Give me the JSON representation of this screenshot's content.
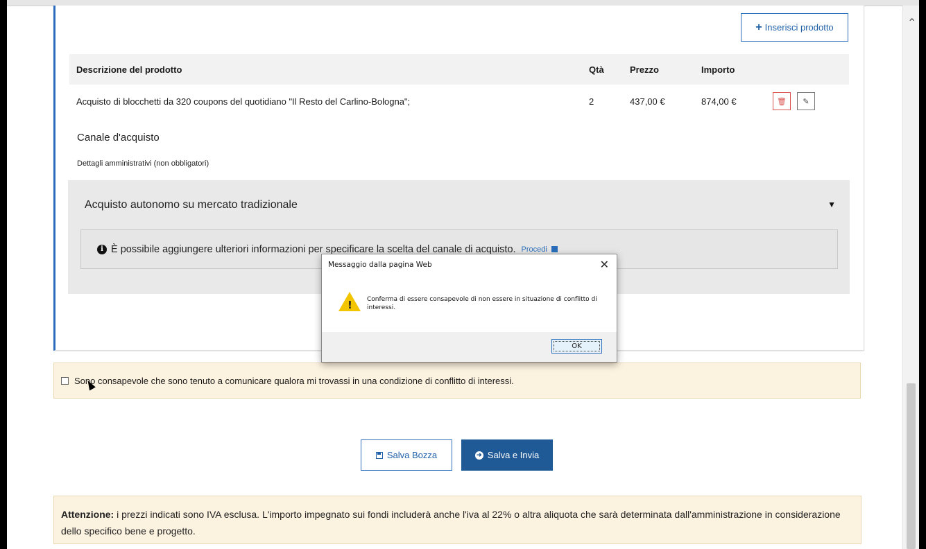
{
  "toolbar": {
    "insert_product_label": "Inserisci prodotto"
  },
  "table": {
    "headers": [
      "Descrizione del prodotto",
      "Qtà",
      "Prezzo",
      "Importo"
    ],
    "rows": [
      {
        "description": "Acquisto di blocchetti da 320 coupons del quotidiano \"Il Resto del Carlino-Bologna\";",
        "qty": "2",
        "price": "437,00 €",
        "amount": "874,00 €"
      }
    ]
  },
  "channel": {
    "title": "Canale d'acquisto",
    "subtitle": "Dettagli amministrativi (non obbligatori)",
    "selected": "Acquisto autonomo su mercato tradizionale",
    "info_text": "È possibile aggiungere ulteriori informazioni per specificare la scelta del canale di acquisto.",
    "info_link": "Procedi"
  },
  "confirm": {
    "label": "Sono consapevole che sono tenuto a comunicare qualora mi trovassi in una condizione di conflitto di interessi."
  },
  "actions": {
    "draft_label": "Salva Bozza",
    "send_label": "Salva e Invia"
  },
  "notice": {
    "strong": "Attenzione:",
    "text": " i prezzi indicati sono IVA esclusa. L'importo impegnato sui fondi includerà anche l'iva al 22% o altra aliquota che sarà determinata dall'amministrazione in considerazione dello specifico bene e progetto."
  },
  "dialog": {
    "title": "Messaggio dalla pagina Web",
    "message": "Conferma di essere consapevole di non essere in situazione di conflitto di interessi.",
    "ok_label": "OK"
  },
  "colors": {
    "accent": "#2a6ebb",
    "primary_button": "#1f5a96",
    "notice_bg": "#fcf2e0",
    "warning": "#f3c400"
  }
}
